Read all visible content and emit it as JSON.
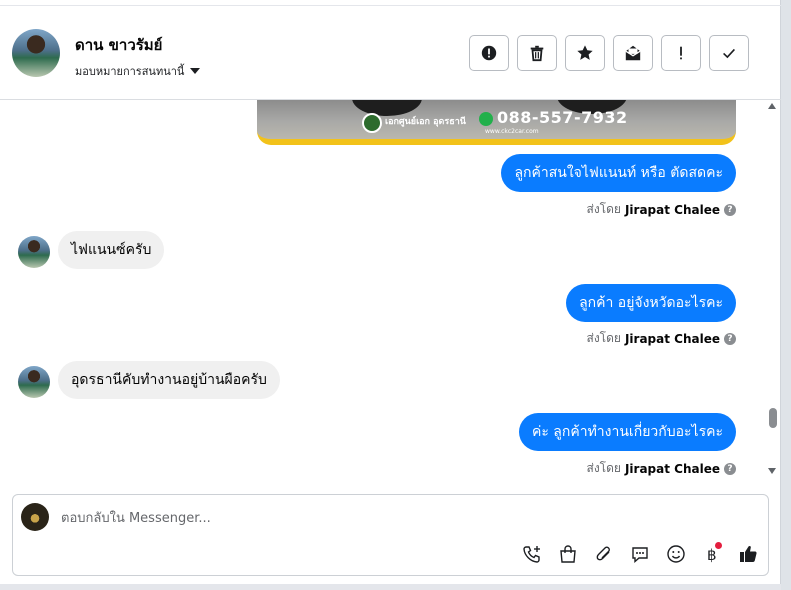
{
  "header": {
    "contact_name": "ดาน ขาวรัมย์",
    "assign_label": "มอบหมายการสนทนานี้",
    "actions": [
      {
        "name": "mark-spam-button",
        "icon": "exclamation-circle-icon"
      },
      {
        "name": "delete-button",
        "icon": "trash-icon"
      },
      {
        "name": "star-button",
        "icon": "star-icon"
      },
      {
        "name": "mark-unread-button",
        "icon": "envelope-open-icon"
      },
      {
        "name": "follow-up-button",
        "icon": "exclamation-icon"
      },
      {
        "name": "mark-done-button",
        "icon": "checkmark-icon"
      }
    ]
  },
  "image_card": {
    "brand": "เอกศูนย์เอก อุดรธานี",
    "phone": "088-557-7932",
    "site": "www.ckc2car.com"
  },
  "messages": [
    {
      "direction": "out",
      "text": "ลูกค้าสนใจไฟแนนท์ หรือ ตัดสดคะ",
      "sent_by_prefix": "ส่งโดย",
      "sent_by_name": "Jirapat Chalee"
    },
    {
      "direction": "in",
      "text": "ไฟแนนซ์ครับ"
    },
    {
      "direction": "out",
      "text": "ลูกค้า อยู่จังหวัดอะไรคะ",
      "sent_by_prefix": "ส่งโดย",
      "sent_by_name": "Jirapat Chalee"
    },
    {
      "direction": "in",
      "text": "อุดรธานีคับทำงานอยู่บ้านผือครับ"
    },
    {
      "direction": "out",
      "text": "ค่ะ ลูกค้าทำงานเกี่ยวกับอะไรคะ",
      "sent_by_prefix": "ส่งโดย",
      "sent_by_name": "Jirapat Chalee"
    }
  ],
  "composer": {
    "placeholder": "ตอบกลับใน Messenger...",
    "tools": [
      "call-add-icon",
      "shopping-bag-icon",
      "paperclip-icon",
      "saved-reply-icon",
      "emoji-icon",
      "baht-payment-icon",
      "thumbs-up-icon"
    ],
    "notification_color": "#e41e3f"
  },
  "colors": {
    "outgoing_bubble": "#0a7cff",
    "incoming_bubble": "#f0f0f0"
  }
}
